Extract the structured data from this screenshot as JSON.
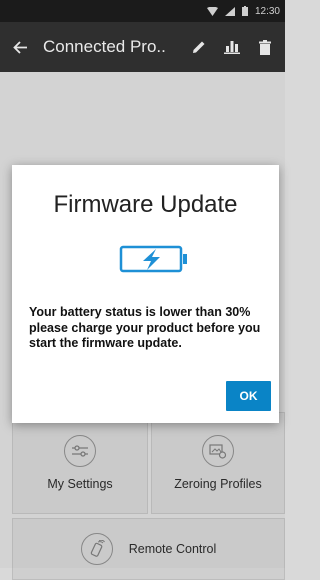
{
  "status_bar": {
    "time": "12:30"
  },
  "app_bar": {
    "title": "Connected Pro.."
  },
  "tiles": {
    "my_settings": "My Settings",
    "zeroing_profiles": "Zeroing Profiles",
    "remote_control": "Remote Control"
  },
  "dialog": {
    "title": "Firmware Update",
    "message": "Your battery status is lower than 30% please charge your product before you start the firmware update.",
    "ok_label": "OK"
  },
  "colors": {
    "accent": "#0a84c6",
    "battery": "#1e90d6",
    "appbar": "#2f2f2f"
  },
  "icons": [
    "back-arrow-icon",
    "edit-pencil-icon",
    "chart-icon",
    "trash-icon",
    "battery-charging-icon",
    "settings-sliders-icon",
    "zeroing-profile-icon",
    "remote-control-icon"
  ]
}
